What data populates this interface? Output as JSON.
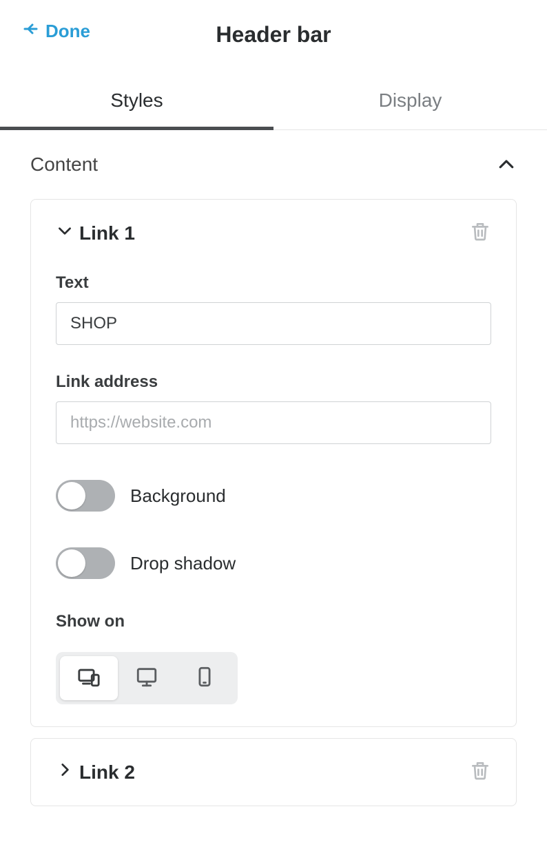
{
  "header": {
    "done_label": "Done",
    "title": "Header bar"
  },
  "tabs": {
    "styles": "Styles",
    "display": "Display"
  },
  "section": {
    "title": "Content"
  },
  "link1": {
    "title": "Link 1",
    "text_label": "Text",
    "text_value": "SHOP",
    "address_label": "Link address",
    "address_placeholder": "https://website.com",
    "background_label": "Background",
    "dropshadow_label": "Drop shadow",
    "showon_label": "Show on"
  },
  "link2": {
    "title": "Link 2"
  }
}
